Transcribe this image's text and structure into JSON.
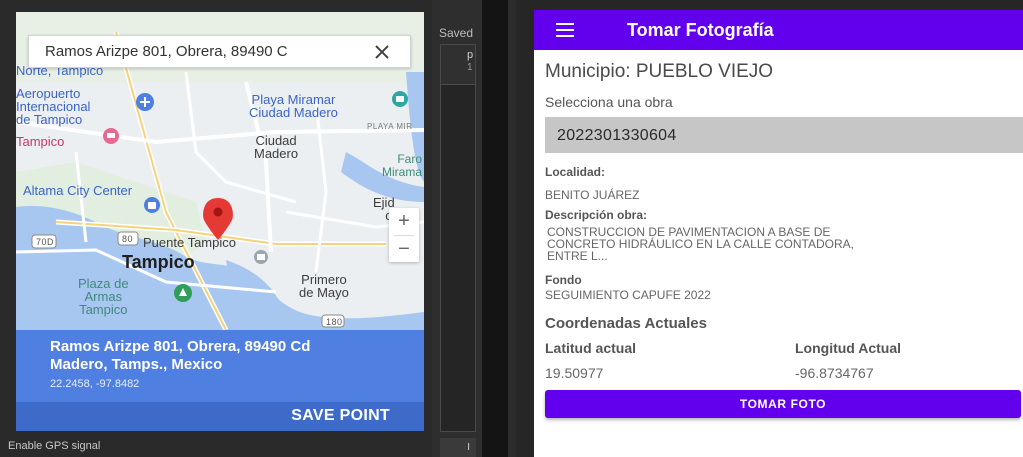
{
  "map": {
    "search_text": "Ramos Arizpe 801, Obrera, 89490 C",
    "labels": {
      "norte": "Norte, Tampico",
      "aeropuerto": "Aeropuerto\nInternacional\nde Tampico",
      "playa_miramar": "Playa Miramar\nCiudad Madero",
      "playa_mir": "PLAYA MIR",
      "tampico_pink": "Tampico",
      "ciudad_madero": "Ciudad\nMadero",
      "faro": "Faro\nMirama",
      "altama": "Altama City Center",
      "ejido": "Ejid\ncl",
      "hwy70": "70D",
      "hwy80": "80",
      "puente": "Puente Tampico",
      "tampico_big": "Tampico",
      "plaza_armas": "Plaza de\nArmas\nTampico",
      "primero_mayo": "Primero\nde Mayo",
      "hwy180": "180"
    },
    "zoom_in": "+",
    "zoom_out": "−",
    "address": "Ramos Arizpe 801, Obrera, 89490 Cd\nMadero, Tamps., Mexico",
    "coords": "22.2458, -97.8482",
    "save_label": "SAVE POINT",
    "gps_label": "Enable GPS signal"
  },
  "saved": {
    "label": "Saved",
    "item_a": "p",
    "item_b": "1",
    "button": "I"
  },
  "app": {
    "title": "Tomar Fotografía",
    "municipio": "Municipio: PUEBLO VIEJO",
    "obra_label": "Selecciona una obra",
    "obra_value": "2022301330604",
    "localidad_label": "Localidad:",
    "localidad_value": "BENITO JUÁREZ",
    "descripcion_label": "Descripción obra:",
    "descripcion_value": "CONSTRUCCION DE PAVIMENTACION A BASE DE\nCONCRETO HIDRÁULICO EN LA CALLE CONTADORA,\nENTRE L...",
    "fondo_label": "Fondo",
    "fondo_value": "SEGUIMIENTO CAPUFE 2022",
    "coords_heading": "Coordenadas Actuales",
    "lat_label": "Latitud actual",
    "lng_label": "Longitud Actual",
    "lat_value": "19.50977",
    "lng_value": "-96.8734767",
    "button_label": "TOMAR FOTO"
  },
  "colors": {
    "app_primary": "#6200ee",
    "address_panel": "#4f7fe0",
    "save_bar": "#3e6bc9",
    "marker": "#e53935"
  }
}
